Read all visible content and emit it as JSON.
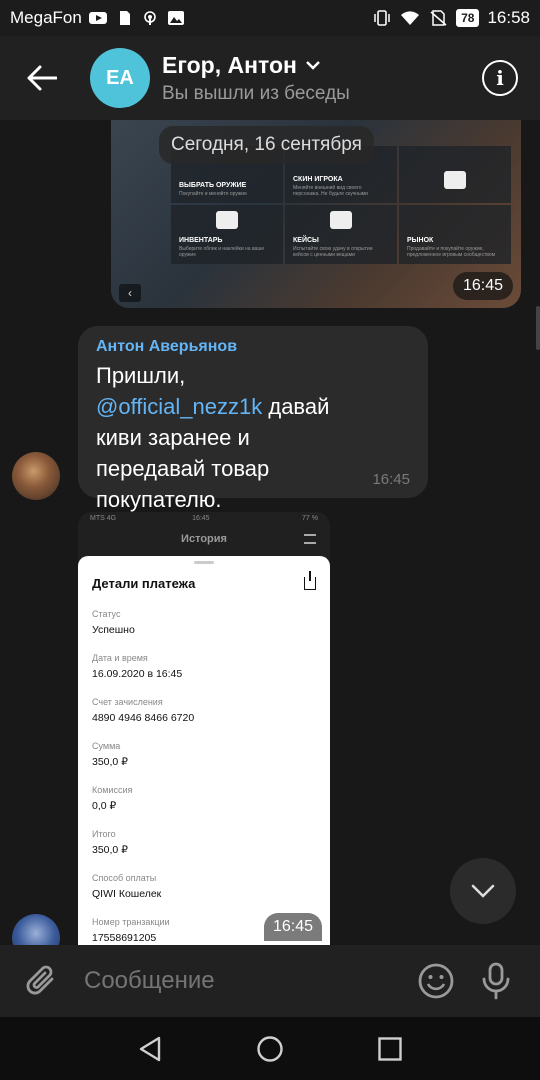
{
  "status_bar": {
    "carrier": "MegaFon",
    "battery": "78",
    "time": "16:58"
  },
  "header": {
    "avatar_initials": "EA",
    "title": "Егор, Антон",
    "subtitle": "Вы вышли из беседы"
  },
  "game_image": {
    "tiles": [
      {
        "title": "ВЫБРАТЬ ОРУЖИЕ",
        "sub": "Покупайте и меняйте оружие"
      },
      {
        "title": "СКИН ИГРОКА",
        "sub": "Меняйте внешний вид своего персонажа. Не будьте скучными"
      },
      {
        "title": "",
        "sub": ""
      },
      {
        "title": "ИНВЕНТАРЬ",
        "sub": "Выберите облик и наклейки на ваше оружие"
      },
      {
        "title": "КЕЙСЫ",
        "sub": "Испытайте свою удачу в открытии кейсов с ценными вещами"
      },
      {
        "title": "РЫНОК",
        "sub": "Продавайте и покупайте оружие, предложенное игровым сообществом"
      }
    ],
    "date_separator": "Сегодня, 16 сентября",
    "time": "16:45"
  },
  "message": {
    "sender": "Антон Аверьянов",
    "text_before": "Пришли, ",
    "mention": "@official_nezz1k",
    "text_after": " давай киви заранее и передавай товар покупателю.",
    "time": "16:45"
  },
  "payment_screenshot": {
    "status_carrier": "MTS 4G",
    "status_time": "16:45",
    "status_battery": "77 %",
    "nav_title": "История",
    "sheet_title": "Детали платежа",
    "fields": [
      {
        "label": "Статус",
        "value": "Успешно"
      },
      {
        "label": "Дата и время",
        "value": "16.09.2020 в 16:45"
      },
      {
        "label": "Счет зачисления",
        "value": "4890 4946 8466 6720"
      },
      {
        "label": "Сумма",
        "value": "350,0 ₽"
      },
      {
        "label": "Комиссия",
        "value": "0,0 ₽"
      },
      {
        "label": "Итого",
        "value": "350,0 ₽"
      },
      {
        "label": "Способ оплаты",
        "value": "QIWI Кошелек"
      },
      {
        "label": "Номер транзакции",
        "value": "17558691205"
      }
    ],
    "time": "16:45"
  },
  "input_bar": {
    "placeholder": "Сообщение"
  },
  "colors": {
    "accent": "#64b5f6",
    "avatar_bg": "#4fc3d9",
    "bubble": "#2b2b2b",
    "background": "#181818"
  },
  "icons": [
    "arrow-left-icon",
    "chevron-down-icon",
    "info-icon",
    "chevron-down-icon",
    "paperclip-icon",
    "emoji-icon",
    "mic-icon",
    "back-triangle-icon",
    "home-circle-icon",
    "recents-square-icon"
  ]
}
